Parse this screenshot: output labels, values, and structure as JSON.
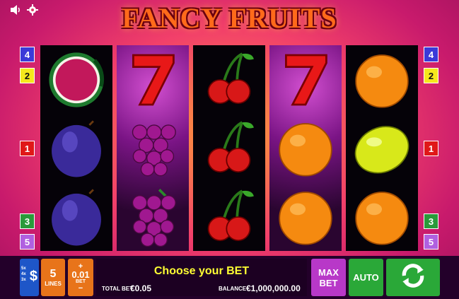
{
  "header": {
    "title": "FANCY FRUITS",
    "icons": [
      "speaker-icon",
      "gear-icon"
    ]
  },
  "line_markers": {
    "left": [
      {
        "num": "4",
        "color": "#3a3ad8"
      },
      {
        "num": "2",
        "color": "#f5e81c"
      },
      {
        "num": "1",
        "color": "#e01818"
      },
      {
        "num": "3",
        "color": "#2a9a3a"
      },
      {
        "num": "5",
        "color": "#b060e0"
      }
    ],
    "right": [
      {
        "num": "4",
        "color": "#3a3ad8"
      },
      {
        "num": "2",
        "color": "#f5e81c"
      },
      {
        "num": "1",
        "color": "#e01818"
      },
      {
        "num": "3",
        "color": "#2a9a3a"
      },
      {
        "num": "5",
        "color": "#b060e0"
      }
    ]
  },
  "reels": [
    [
      "watermelon",
      "plum",
      "plum"
    ],
    [
      "seven",
      "grapes",
      "grapes"
    ],
    [
      "cherries",
      "cherries",
      "cherries"
    ],
    [
      "seven",
      "orange",
      "orange"
    ],
    [
      "orange",
      "lemon",
      "orange"
    ]
  ],
  "controls": {
    "paytable_labels": [
      "5x",
      "4x",
      "3x"
    ],
    "paytable_symbol": "$",
    "lines_value": "5",
    "lines_label": "LINES",
    "bet_plus": "+",
    "bet_value": "0.01",
    "bet_label": "BET",
    "bet_minus": "−",
    "message": "Choose your BET",
    "total_bet_label": "TOTAL BET",
    "total_bet_value": "€0.05",
    "balance_label": "BALANCE",
    "balance_value": "€1,000,000.00",
    "max_bet_line1": "MAX",
    "max_bet_line2": "BET",
    "auto_label": "AUTO",
    "spin_icon": "spin-arrows-icon"
  },
  "colors": {
    "paytable": "#1e56c8",
    "lines": "#e8741a",
    "bet": "#e8741a",
    "max_bet": "#b838c8",
    "auto": "#2aa838",
    "spin": "#2aa838"
  }
}
